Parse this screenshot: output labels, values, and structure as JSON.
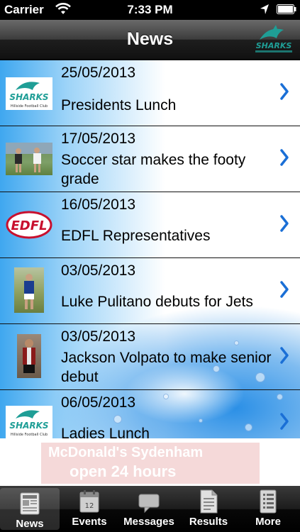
{
  "status_bar": {
    "carrier": "Carrier",
    "time": "7:33 PM"
  },
  "nav": {
    "title": "News",
    "logo_text": "SHARKS"
  },
  "news_items": [
    {
      "date": "25/05/2013",
      "title": "Presidents Lunch",
      "thumbnail": "sharks-logo",
      "logo_text": "SHARKS",
      "logo_subtext": "Hillside Football Club"
    },
    {
      "date": "17/05/2013",
      "title": "Soccer star makes the footy grade",
      "thumbnail": "football-photo"
    },
    {
      "date": "16/05/2013",
      "title": "EDFL Representatives",
      "thumbnail": "edfl-logo",
      "logo_text": "EDFL"
    },
    {
      "date": "03/05/2013",
      "title": "Luke Pulitano debuts for Jets",
      "thumbnail": "player-photo"
    },
    {
      "date": "03/05/2013",
      "title": "Jackson Volpato to make senior debut",
      "thumbnail": "player-photo"
    },
    {
      "date": "06/05/2013",
      "title": "Ladies Lunch",
      "thumbnail": "sharks-logo",
      "logo_text": "SHARKS",
      "logo_subtext": "Hillside Football Club"
    }
  ],
  "ad": {
    "line1": "McDonald's Sydenham",
    "line2": "open 24 hours"
  },
  "tabs": [
    {
      "label": "News",
      "icon": "newspaper-icon",
      "selected": true
    },
    {
      "label": "Events",
      "icon": "calendar-icon",
      "calendar_day": "12",
      "selected": false
    },
    {
      "label": "Messages",
      "icon": "speech-bubble-icon",
      "selected": false
    },
    {
      "label": "Results",
      "icon": "document-icon",
      "selected": false
    },
    {
      "label": "More",
      "icon": "list-icon",
      "selected": false
    }
  ],
  "colors": {
    "accent_chevron": "#1a6fd6",
    "sharks_teal": "#1f9e96",
    "water_blue": "#2a8fe6"
  }
}
